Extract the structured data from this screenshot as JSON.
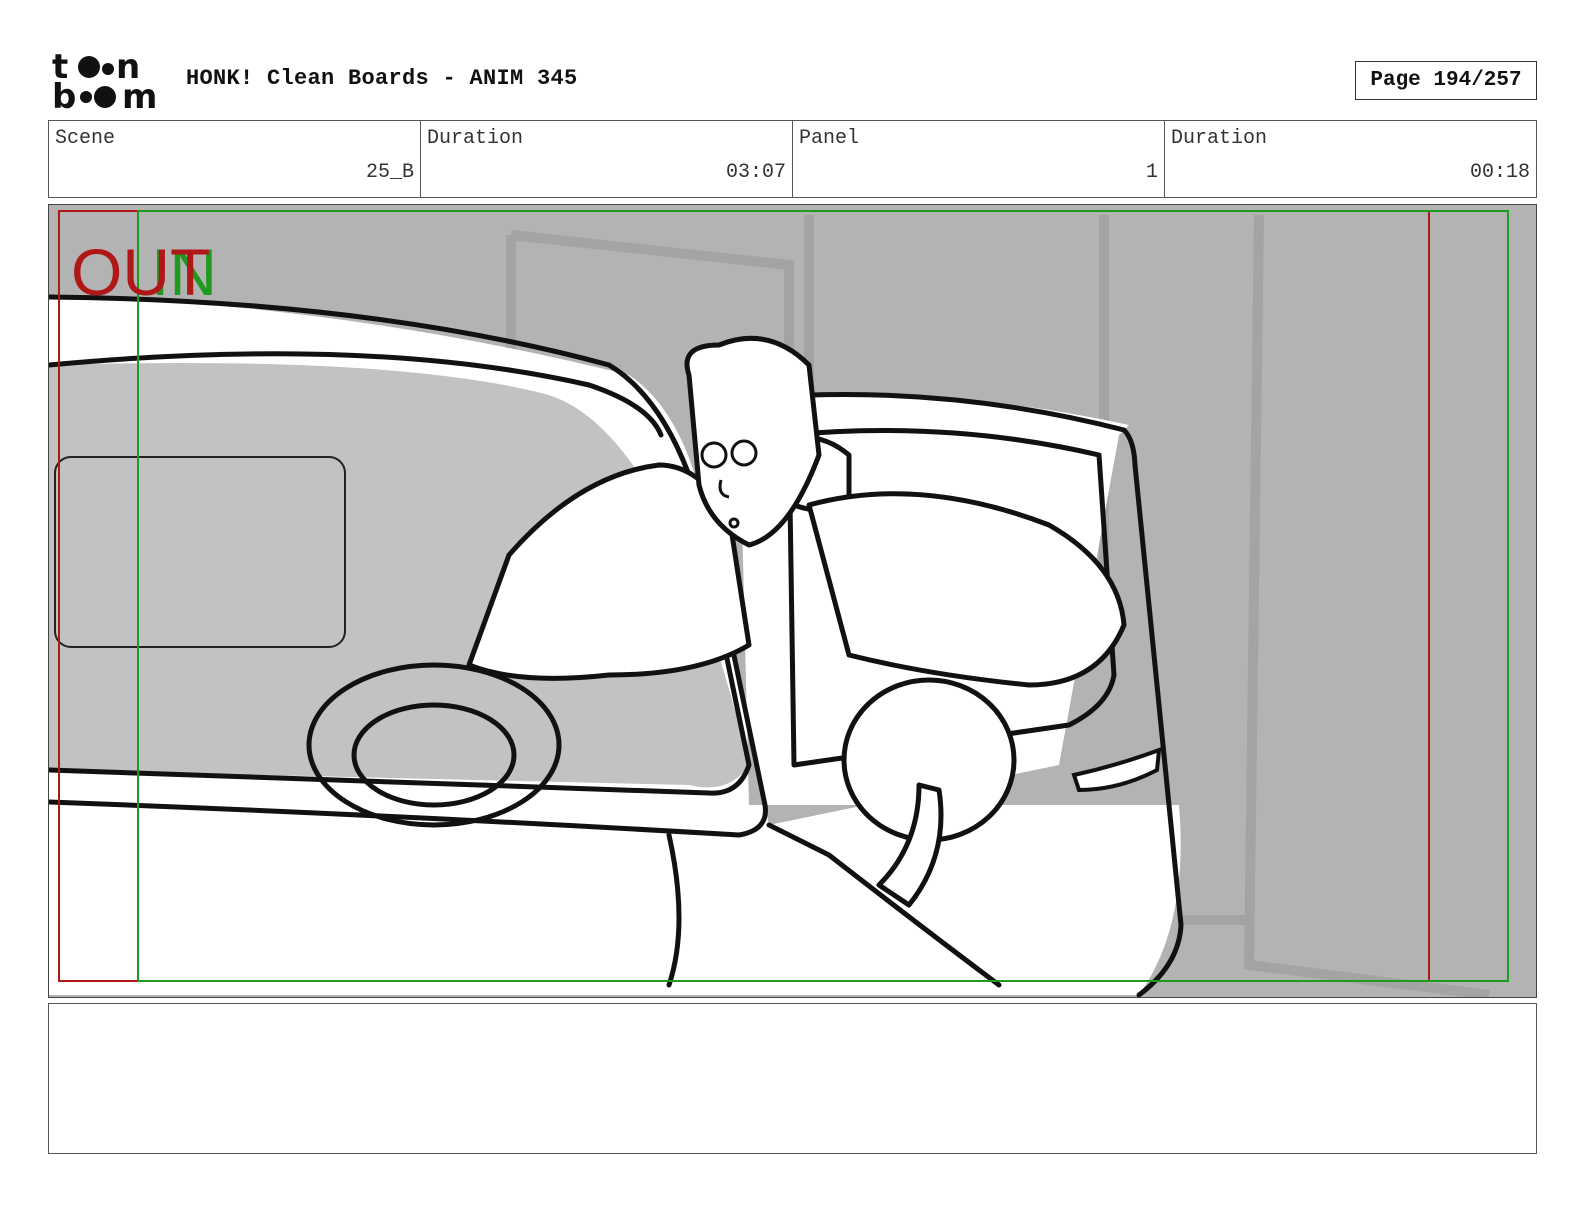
{
  "header": {
    "logo_text": "toon boom",
    "title": "HONK! Clean Boards - ANIM 345",
    "page_indicator": "Page 194/257"
  },
  "info": {
    "scene_label": "Scene",
    "scene_value": "25_B",
    "scene_duration_label": "Duration",
    "scene_duration_value": "03:07",
    "panel_label": "Panel",
    "panel_value": "1",
    "panel_duration_label": "Duration",
    "panel_duration_value": "00:18"
  },
  "panel": {
    "out_marker": "OUT",
    "in_marker": "IN",
    "colors": {
      "out": "#b01818",
      "in": "#1e9a1e",
      "background": "#b3b3b3"
    }
  },
  "notes": {
    "text": ""
  }
}
